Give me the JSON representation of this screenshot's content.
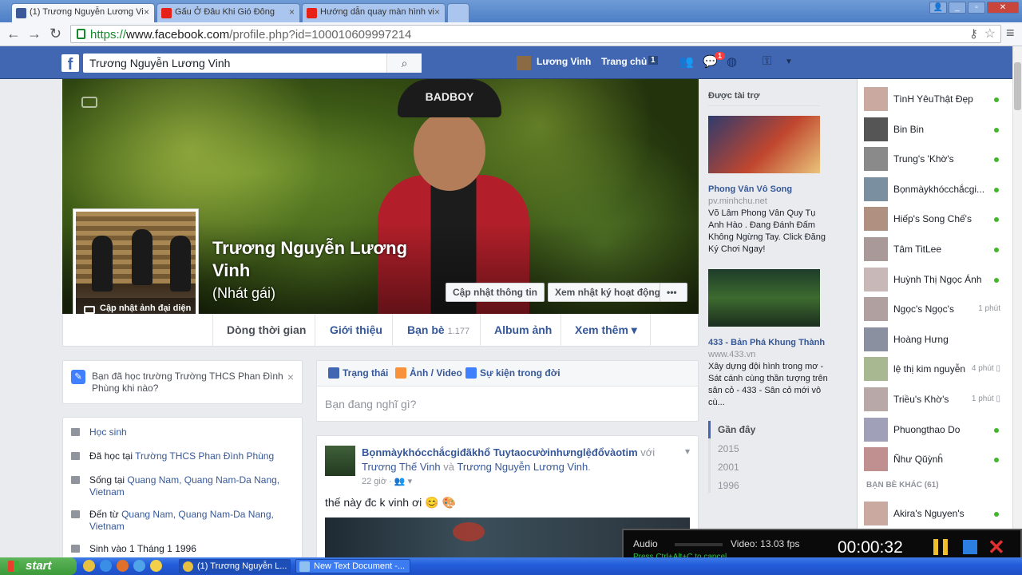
{
  "tabs": [
    {
      "title": "(1) Trương Nguyễn Lương Vi",
      "icon": "facebook-icon"
    },
    {
      "title": "Gấu Ở Đâu Khi Gió Đông",
      "icon": "youtube-icon"
    },
    {
      "title": "Hướng dẫn quay màn hình vi",
      "icon": "youtube-icon"
    }
  ],
  "address": {
    "scheme": "https://",
    "host": "www.facebook.com",
    "path": "/profile.php?id=100010609997214"
  },
  "bluebar": {
    "search_value": "Trương Nguyễn Lương Vinh",
    "user_name": "Lương Vinh",
    "home_label": "Trang chủ",
    "home_count": "1",
    "notif_count": "1"
  },
  "profile": {
    "name": "Trương Nguyễn Lương Vinh",
    "alt_name": "(Nhát gái)",
    "update_photo": "Cập nhật ảnh đại diện",
    "btn_update_info": "Cập nhật thông tin",
    "btn_activity_log": "Xem nhật ký hoạt động",
    "btn_more": "•••",
    "hat_text": "BADBOY"
  },
  "nav_tabs": [
    {
      "label": "Dòng thời gian"
    },
    {
      "label": "Giới thiệu"
    },
    {
      "label": "Bạn bè",
      "count": "1.177"
    },
    {
      "label": "Album ảnh"
    },
    {
      "label": "Xem thêm ▾"
    }
  ],
  "school_prompt": {
    "text": "Bạn đã học trường Trường THCS Phan Đình Phùng khi nào?",
    "close": "×"
  },
  "intro": [
    {
      "text": "Học sinh",
      "link": ""
    },
    {
      "text": "Đã học tại ",
      "link": "Trường THCS Phan Đình Phùng"
    },
    {
      "text": "Sống tại ",
      "link": "Quang Nam, Quang Nam-Da Nang, Vietnam"
    },
    {
      "text": "Đến từ ",
      "link": "Quang Nam, Quang Nam-Da Nang, Vietnam"
    },
    {
      "text": "Sinh vào 1 Tháng 1 1996",
      "link": ""
    }
  ],
  "composer": {
    "tabs": [
      "Trạng thái",
      "Ảnh / Video",
      "Sự kiện trong đời"
    ],
    "placeholder": "Bạn đang nghĩ gì?"
  },
  "post": {
    "author": "Bọnmàykhócchắcgiđãkhổ Tuytaocườinhưnglệđổvàotim",
    "with_word": " với ",
    "tagged1": "Trương Thế Vinh",
    "and_word": " và ",
    "tagged2": "Trương Nguyễn Lương Vinh",
    "time": "22 giờ · 👥 ▾",
    "body": "thế này đc k vinh ơi 😊 🎨"
  },
  "ads": {
    "header": "Được tài trợ",
    "items": [
      {
        "title": "Phong Vân Vô Song",
        "domain": "pv.minhchu.net",
        "desc": "Võ Lâm Phong Vân Quy Tụ Anh Hào . Đang Đánh Đấm Không Ngừng Tay. Click Đăng Ký Chơi Ngay!"
      },
      {
        "title": "433 - Bản Phá Khung Thành",
        "domain": "www.433.vn",
        "desc": "Xây dựng đội hình trong mơ - Sát cánh cùng thần tượng trên sân cỏ - 433 - Sân cỏ mới vô cù..."
      }
    ]
  },
  "years": [
    "Gần đây",
    "2015",
    "2001",
    "1996"
  ],
  "chat": {
    "friends": [
      {
        "name": "TìnH YêuThật Đẹp",
        "status": "online"
      },
      {
        "name": "Bin Bin",
        "status": "online"
      },
      {
        "name": "Trung's 'Khờ's",
        "status": "online"
      },
      {
        "name": "Bọnmàykhócchắcgi...",
        "status": "online"
      },
      {
        "name": "Hiếp's Song Chế's",
        "status": "online"
      },
      {
        "name": "Tâm TitLee",
        "status": "online"
      },
      {
        "name": "Huỳnh Thị Ngọc Ánh",
        "status": "online"
      },
      {
        "name": "Ngọc's Ngọc's",
        "status": "1 phút"
      },
      {
        "name": "Hoàng Hưng",
        "status": "none"
      },
      {
        "name": "lệ thị kim nguyễn",
        "status": "4 phút ▯"
      },
      {
        "name": "Triều's Khờ's",
        "status": "1 phút ▯"
      },
      {
        "name": "Phuongthao Do",
        "status": "online"
      },
      {
        "name": "Ñhư Qŭỳnĥ",
        "status": "online"
      }
    ],
    "other_header": "BẠN BÈ KHÁC (61)",
    "other": [
      {
        "name": "Akira's Nguyen's",
        "status": "online"
      }
    ]
  },
  "recorder": {
    "audio_label": "Audio",
    "video_label": "Video: 13.03 fps",
    "hint": "Press Ctrl+Alt+C to cancel",
    "timer": "00:00:32"
  },
  "taskbar": {
    "start": "start",
    "items": [
      "(1) Trương Nguyễn L...",
      "New Text Document -..."
    ]
  }
}
